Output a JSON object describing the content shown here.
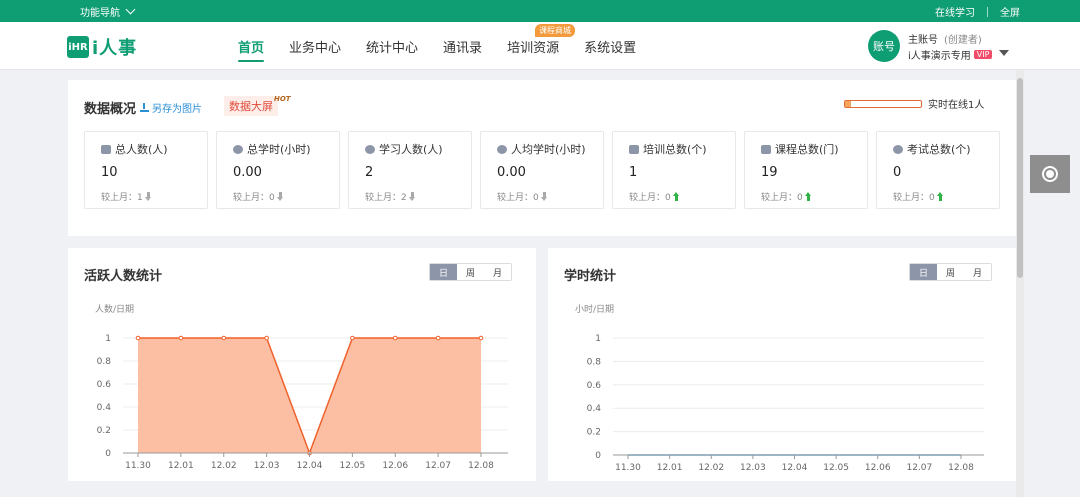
{
  "topbar": {
    "nav_label": "功能导航",
    "links": [
      "在线学习",
      "全屏"
    ]
  },
  "header": {
    "logo_mark": "iHR",
    "logo_text": "i人事",
    "nav": [
      {
        "label": "首页",
        "active": true
      },
      {
        "label": "业务中心"
      },
      {
        "label": "统计中心"
      },
      {
        "label": "通讯录"
      },
      {
        "label": "培训资源",
        "badge": "课程商城"
      },
      {
        "label": "系统设置"
      }
    ],
    "account": {
      "avatar": "账号",
      "role": "主账号",
      "role_sub": "(创建者)",
      "company": "i人事演示专用",
      "vip": "VIP"
    }
  },
  "overview": {
    "title": "数据概况",
    "save_label": "另存为图片",
    "big_screen": "数据大屏",
    "hot": "HOT",
    "online_label": "实时在线1人",
    "online_fraction": 0.08,
    "stats": [
      {
        "name": "总人数(人)",
        "value": "10",
        "compare": "较上月：1",
        "trend": "down",
        "icon": "building-icon"
      },
      {
        "name": "总学时(小时)",
        "value": "0.00",
        "compare": "较上月：0",
        "trend": "down",
        "icon": "clock-icon"
      },
      {
        "name": "学习人数(人)",
        "value": "2",
        "compare": "较上月：2",
        "trend": "down",
        "icon": "users-icon"
      },
      {
        "name": "人均学时(小时)",
        "value": "0.00",
        "compare": "较上月：0",
        "trend": "down",
        "icon": "person-icon"
      },
      {
        "name": "培训总数(个)",
        "value": "1",
        "compare": "较上月：0",
        "trend": "up",
        "icon": "video-icon"
      },
      {
        "name": "课程总数(门)",
        "value": "19",
        "compare": "较上月：0",
        "trend": "up",
        "icon": "list-icon"
      },
      {
        "name": "考试总数(个)",
        "value": "0",
        "compare": "较上月：0",
        "trend": "up",
        "icon": "pin-icon"
      }
    ]
  },
  "colors": {
    "brand": "#0f9d73",
    "area_fill": "#fcbfa4",
    "area_line": "#f0622c",
    "flat_line": "#4aa8e0"
  },
  "chart_data": [
    {
      "type": "area",
      "title": "活跃人数统计",
      "ylabel": "人数/日期",
      "toggle": [
        "日",
        "周",
        "月"
      ],
      "toggle_active": "日",
      "x": [
        "11.30",
        "12.01",
        "12.02",
        "12.03",
        "12.04",
        "12.05",
        "12.06",
        "12.07",
        "12.08"
      ],
      "values": [
        1,
        1,
        1,
        1,
        0,
        1,
        1,
        1,
        1
      ],
      "yticks": [
        "0",
        "0.2",
        "0.4",
        "0.6",
        "0.8",
        "1"
      ],
      "ylim": [
        0,
        1
      ],
      "grid": true
    },
    {
      "type": "line",
      "title": "学时统计",
      "ylabel": "小时/日期",
      "toggle": [
        "日",
        "周",
        "月"
      ],
      "toggle_active": "日",
      "x": [
        "11.30",
        "12.01",
        "12.02",
        "12.03",
        "12.04",
        "12.05",
        "12.06",
        "12.07",
        "12.08"
      ],
      "values": [
        0,
        0,
        0,
        0,
        0,
        0,
        0,
        0,
        0
      ],
      "yticks": [
        "0",
        "0.2",
        "0.4",
        "0.6",
        "0.8",
        "1"
      ],
      "ylim": [
        0,
        1
      ],
      "grid": true
    }
  ]
}
